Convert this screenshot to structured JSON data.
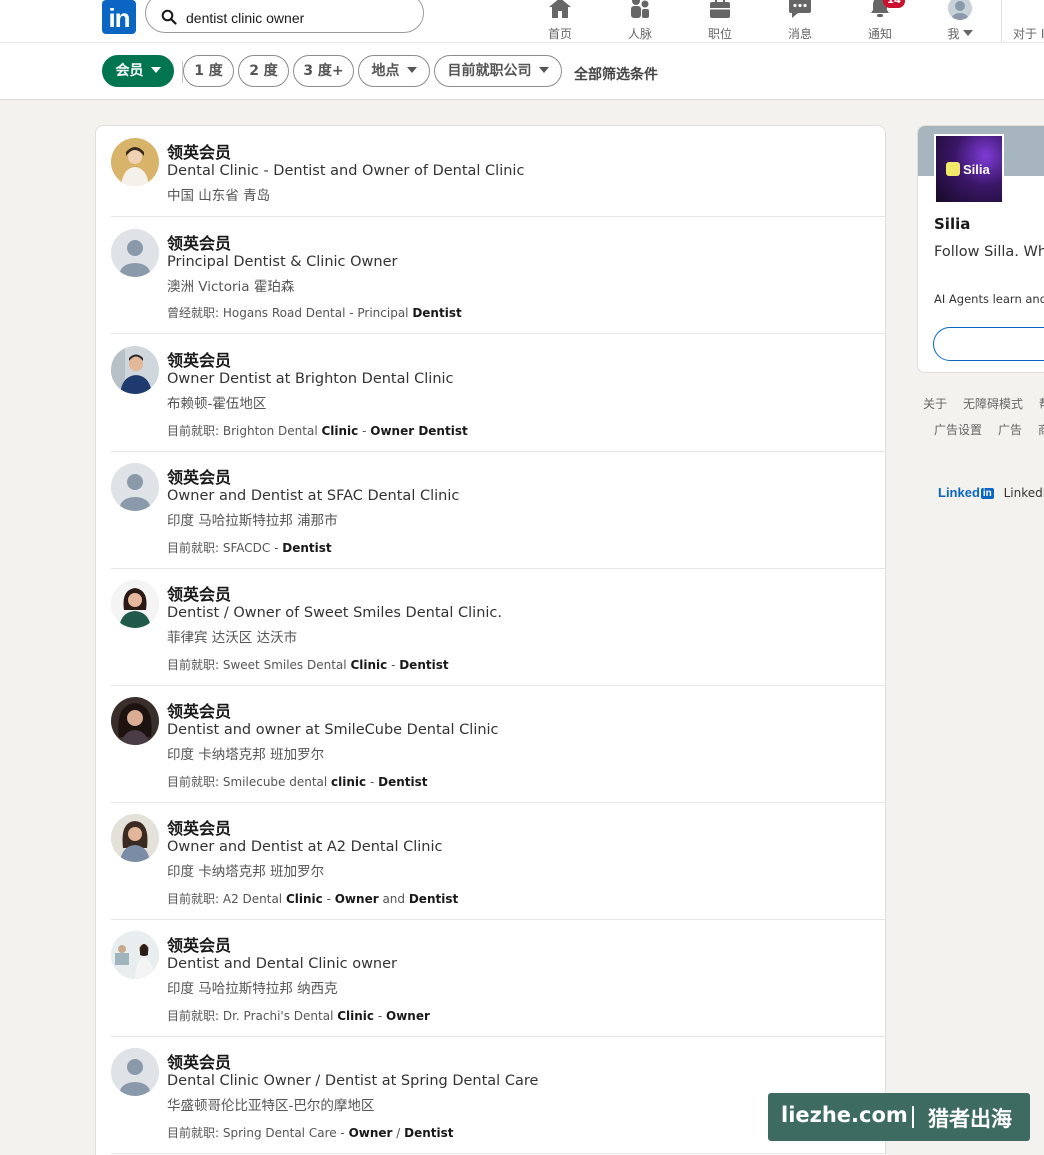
{
  "nav": {
    "search_value": "dentist clinic owner",
    "items": [
      {
        "label": "首页",
        "icon": "home-icon"
      },
      {
        "label": "人脉",
        "icon": "network-icon"
      },
      {
        "label": "职位",
        "icon": "jobs-icon"
      },
      {
        "label": "消息",
        "icon": "messaging-icon"
      },
      {
        "label": "通知",
        "icon": "bell-icon",
        "badge": "14"
      },
      {
        "label": "我",
        "icon": "avatar"
      }
    ],
    "right_label": "对于 I"
  },
  "filters": {
    "member": "会员",
    "first": "1 度",
    "second": "2 度",
    "third": "3 度+",
    "location": "地点",
    "company": "目前就职公司",
    "all": "全部筛选条件"
  },
  "results": [
    {
      "name": "领英会员",
      "headline": "Dental Clinic - Dentist and Owner of Dental Clinic",
      "location": "中国 山东省 青岛",
      "info_prefix": "",
      "info_parts": []
    },
    {
      "name": "领英会员",
      "headline": "Principal Dentist & Clinic Owner",
      "location": "澳洲 Victoria 霍珀森",
      "info_prefix": "曾经就职: ",
      "info_parts": [
        {
          "t": "Hogans Road Dental - Principal ",
          "b": false
        },
        {
          "t": "Dentist",
          "b": true
        }
      ]
    },
    {
      "name": "领英会员",
      "headline": "Owner Dentist at Brighton Dental Clinic",
      "location": "布赖顿-霍伍地区",
      "info_prefix": "目前就职: ",
      "info_parts": [
        {
          "t": "Brighton Dental ",
          "b": false
        },
        {
          "t": "Clinic",
          "b": true
        },
        {
          "t": " - ",
          "b": false
        },
        {
          "t": "Owner Dentist",
          "b": true
        }
      ]
    },
    {
      "name": "领英会员",
      "headline": "Owner and Dentist at SFAC Dental Clinic",
      "location": "印度 马哈拉斯特拉邦 浦那市",
      "info_prefix": "目前就职: ",
      "info_parts": [
        {
          "t": "SFACDC - ",
          "b": false
        },
        {
          "t": "Dentist",
          "b": true
        }
      ]
    },
    {
      "name": "领英会员",
      "headline": "Dentist / Owner of Sweet Smiles Dental Clinic.",
      "location": "菲律宾 达沃区 达沃市",
      "info_prefix": "目前就职: ",
      "info_parts": [
        {
          "t": "Sweet Smiles Dental ",
          "b": false
        },
        {
          "t": "Clinic",
          "b": true
        },
        {
          "t": " - ",
          "b": false
        },
        {
          "t": "Dentist",
          "b": true
        }
      ]
    },
    {
      "name": "领英会员",
      "headline": "Dentist and owner at SmileCube Dental Clinic",
      "location": "印度 卡纳塔克邦 班加罗尔",
      "info_prefix": "目前就职: ",
      "info_parts": [
        {
          "t": "Smilecube dental ",
          "b": false
        },
        {
          "t": "clinic",
          "b": true
        },
        {
          "t": " - ",
          "b": false
        },
        {
          "t": "Dentist",
          "b": true
        }
      ]
    },
    {
      "name": "领英会员",
      "headline": "Owner and Dentist at A2 Dental Clinic",
      "location": "印度 卡纳塔克邦 班加罗尔",
      "info_prefix": "目前就职: ",
      "info_parts": [
        {
          "t": "A2 Dental ",
          "b": false
        },
        {
          "t": "Clinic",
          "b": true
        },
        {
          "t": " - ",
          "b": false
        },
        {
          "t": "Owner",
          "b": true
        },
        {
          "t": " and ",
          "b": false
        },
        {
          "t": "Dentist",
          "b": true
        }
      ]
    },
    {
      "name": "领英会员",
      "headline": "Dentist and Dental Clinic owner",
      "location": "印度 马哈拉斯特拉邦 纳西克",
      "info_prefix": "目前就职: ",
      "info_parts": [
        {
          "t": "Dr. Prachi's Dental ",
          "b": false
        },
        {
          "t": "Clinic",
          "b": true
        },
        {
          "t": " - ",
          "b": false
        },
        {
          "t": "Owner",
          "b": true
        }
      ]
    },
    {
      "name": "领英会员",
      "headline": "Dental Clinic  Owner / Dentist at Spring Dental Care",
      "location": "华盛顿哥伦比亚特区-巴尔的摩地区",
      "info_prefix": "目前就职: ",
      "info_parts": [
        {
          "t": "Spring Dental Care - ",
          "b": false
        },
        {
          "t": "Owner",
          "b": true
        },
        {
          "t": " / ",
          "b": false
        },
        {
          "t": "Dentist",
          "b": true
        }
      ]
    }
  ],
  "ad": {
    "logo_text": "Silia",
    "name": "Silia",
    "text": "Follow Silla. What doing.",
    "text2": "AI Agents learn and"
  },
  "footer": {
    "links": [
      "关于",
      "无障碍模式",
      "帮",
      "广告设置",
      "广告",
      "商"
    ],
    "brand": "Linked",
    "brand_in": "in",
    "brand_text": "LinkedI"
  },
  "watermark": {
    "site": "liezhe.com",
    "brand": "猎者出海"
  },
  "colors": {
    "brand": "#0a66c2",
    "active_filter": "#01754f",
    "badge": "#cb112d"
  }
}
